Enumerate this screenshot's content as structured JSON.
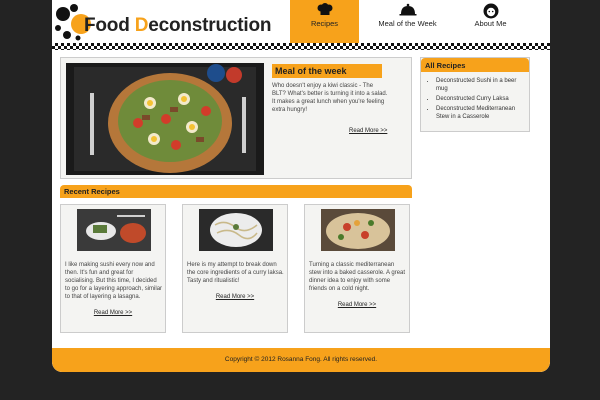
{
  "logo": {
    "prefix": "F",
    "word1": "ood ",
    "accent": "D",
    "word2": "econstruction"
  },
  "nav": [
    {
      "label": "Recipes",
      "icon": "chef-hat-icon",
      "active": true
    },
    {
      "label": "Meal of the Week",
      "icon": "cloche-icon",
      "active": false
    },
    {
      "label": "About Me",
      "icon": "person-icon",
      "active": false
    }
  ],
  "featured": {
    "title": "Meal of the week",
    "text": "Who doesn't enjoy a kiwi classic - The BLT? What's better is turning it into a salad. It makes a great lunch when you're feeling extra hungry!",
    "more": "Read More >>"
  },
  "sidebar": {
    "title": "All Recipes",
    "items": [
      "Deconstructed Sushi in a beer mug",
      "Deconstructed Curry Laksa",
      "Deconstructed Mediterranean Stew in a Casserole"
    ]
  },
  "recent": {
    "title": "Recent Recipes",
    "cards": [
      {
        "text": "I like making sushi every now and then. It's fun and great for socialising. But this time, I decided to go for a layering approach, similar to that of layering a lasagna.",
        "more": "Read More >>"
      },
      {
        "text": "Here is my attempt to break down the core ingredients of a curry laksa. Tasty and ritualistic!",
        "more": "Read More >>"
      },
      {
        "text": "Turning a classic mediterranean stew into a baked casserole. A great dinner idea to enjoy with some friends on a cold night.",
        "more": "Read More >>"
      }
    ]
  },
  "footer": {
    "copyright": "Copyright © 2012 Rosanna Fong. All rights reserved."
  },
  "colors": {
    "accent": "#f7a21b",
    "background": "#232323"
  }
}
